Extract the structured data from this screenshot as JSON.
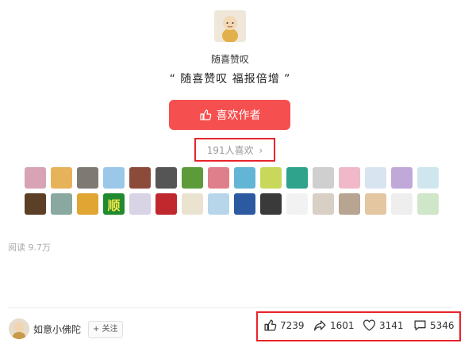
{
  "author": {
    "name": "随喜赞叹",
    "quote": "“ 随喜赞叹 福报倍增 ”"
  },
  "like_button": {
    "label": "喜欢作者",
    "icon": "thumbs-up-icon"
  },
  "likes": {
    "text": "191人喜欢",
    "icon": "chevron-right-icon"
  },
  "liker_avatars": [
    [
      "#d7a3b5",
      "#e7b35a",
      "#7e7a73",
      "#9bc7e8",
      "#8c4a3a",
      "#555555",
      "#5d9b3a",
      "#e07f8c",
      "#63b5d6",
      "#c9d85a",
      "#2fa38c",
      "#cfcfcf",
      "#f0b8c8",
      "#d8e4ef",
      "#c0a8d8",
      "#cfe6ef"
    ],
    [
      "#5b3f26",
      "#88a8a0",
      "#e0a533",
      "#1f8a2e",
      "#d9d3e6",
      "#c0282d",
      "#e9e3cf",
      "#b8d6ea",
      "#2c5aa0",
      "#3a3a3a",
      "#f2f2f2",
      "#d8cfc5",
      "#b7a591",
      "#e4c6a1",
      "#eeeeee",
      "#cfe6c9"
    ]
  ],
  "thumb_text": {
    "r2c4": "顺"
  },
  "reads": "阅读 9.7万",
  "footer": {
    "author_name": "如意小佛陀",
    "follow_label": "+ 关注",
    "stats": {
      "likes": "7239",
      "shares": "1601",
      "favorites": "3141",
      "comments": "5346"
    }
  },
  "colors": {
    "accent": "#f5504f",
    "highlight_border": "#e8242a"
  }
}
